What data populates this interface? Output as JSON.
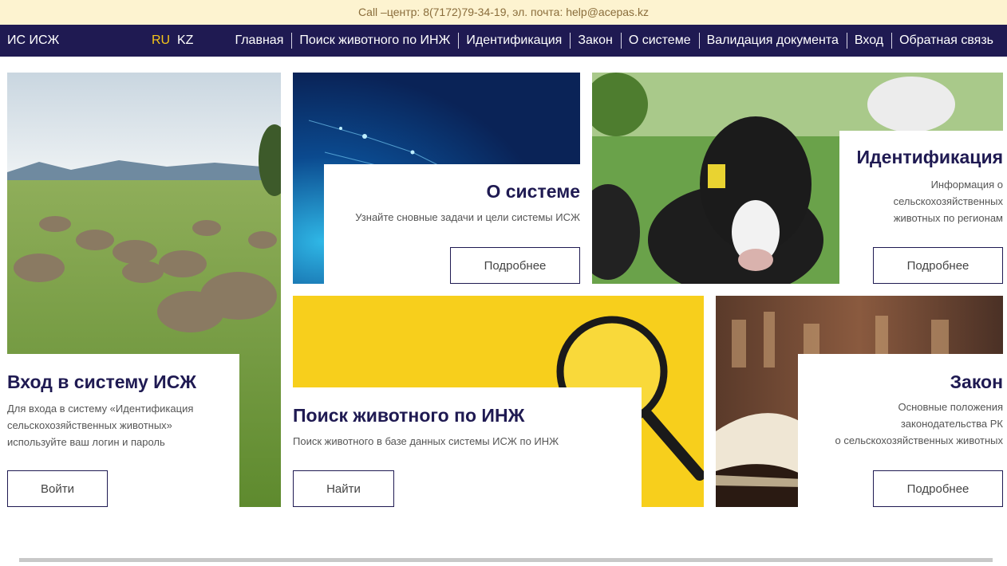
{
  "topbar": {
    "contact_text": "Call –центр: 8(7172)79-34-19, эл. почта: help@acepas.kz"
  },
  "navbar": {
    "brand": "ИС ИСЖ",
    "lang_ru": "RU",
    "lang_kz": "KZ",
    "menu": [
      "Главная",
      "Поиск животного по ИНЖ",
      "Идентификация",
      "Закон",
      "О системе",
      "Валидация документа",
      "Вход",
      "Обратная связь"
    ]
  },
  "cards": {
    "login": {
      "title": "Вход в систему ИСЖ",
      "desc_lines": [
        "Для входа в систему «Идентификация",
        "сельскохозяйственных животных»",
        "используйте ваш логин и пароль"
      ],
      "button": "Войти"
    },
    "about": {
      "title": "О системе",
      "desc": "Узнайте сновные задачи и цели системы ИСЖ",
      "button": "Подробнее"
    },
    "identification": {
      "title": "Идентификация",
      "desc_lines": [
        "Информация о",
        "сельскохозяйственных",
        "животных по регионам"
      ],
      "button": "Подробнее"
    },
    "search": {
      "title": "Поиск животного по ИНЖ",
      "desc": "Поиск животного в базе данных системы ИСЖ по ИНЖ",
      "button": "Найти"
    },
    "law": {
      "title": "Закон",
      "desc_lines": [
        "Основные положения",
        "законодательства РК",
        "о сельскохозяйственных животных"
      ],
      "button": "Подробнее"
    }
  },
  "colors": {
    "navy": "#1f1a52",
    "accent": "#f5c518",
    "topbar_bg": "#fdf3d0"
  }
}
